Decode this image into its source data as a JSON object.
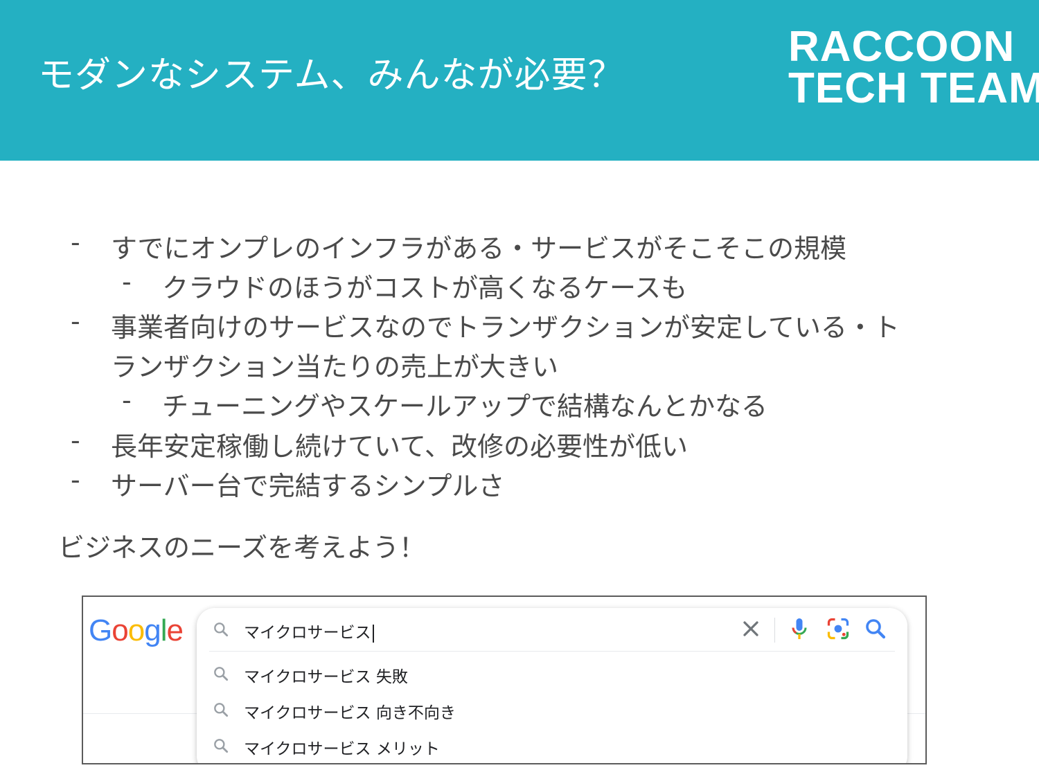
{
  "slide": {
    "title": "モダンなシステム、みんなが必要？",
    "logo_line1": "RACCOON",
    "logo_line2": "TECH TEAM",
    "header_color": "#24b0c2"
  },
  "bullets": [
    {
      "dash": "-",
      "text": "すでにオンプレのインフラがある・サービスがそこそこの規模"
    },
    {
      "dash": "-",
      "text": "クラウドのほうがコストが高くなるケースも"
    },
    {
      "dash": "-",
      "text": "事業者向けのサービスなのでトランザクションが安定している・ト"
    },
    {
      "dash": "",
      "text": "ランザクション当たりの売上が大きい"
    },
    {
      "dash": "-",
      "text": "チューニングやスケールアップで結構なんとかなる"
    },
    {
      "dash": "-",
      "text": "長年安定稼働し続けていて、改修の必要性が低い"
    },
    {
      "dash": "-",
      "text": "サーバー台で完結するシンプルさ"
    }
  ],
  "closing": "ビジネスのニーズを考えよう！",
  "google": {
    "logo": [
      "G",
      "o",
      "o",
      "g",
      "l",
      "e"
    ],
    "logo_colors": [
      "#4285f4",
      "#ea4335",
      "#fbbc05",
      "#4285f4",
      "#34a853",
      "#ea4335"
    ],
    "query": "マイクロサービス",
    "suggestions": [
      "マイクロサービス 失敗",
      "マイクロサービス 向き不向き",
      "マイクロサービス メリット"
    ],
    "icons": {
      "search": "search-icon",
      "clear": "clear-icon",
      "voice": "microphone-icon",
      "lens": "camera-lens-icon"
    }
  }
}
